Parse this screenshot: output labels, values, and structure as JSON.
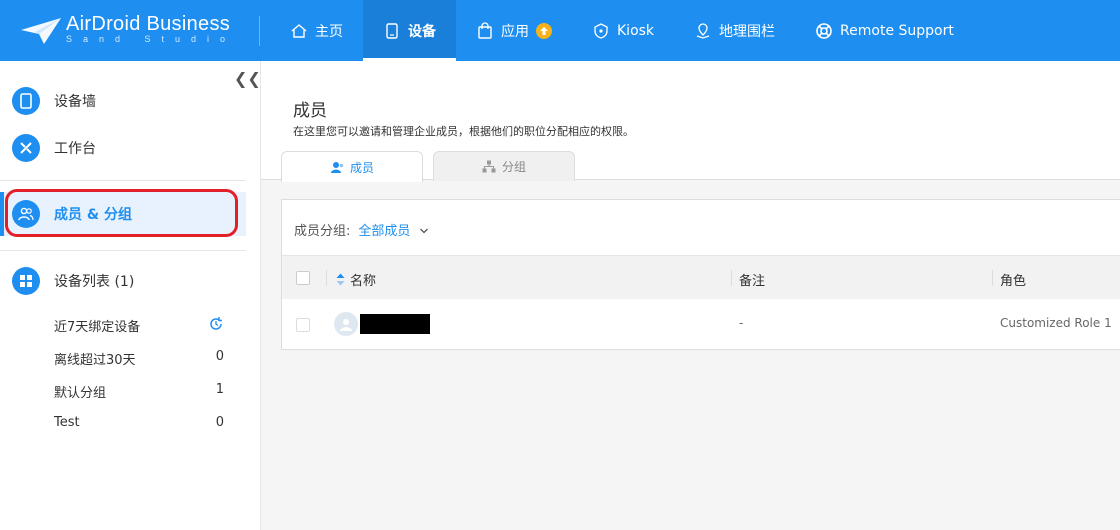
{
  "app": {
    "logo_title": "AirDroid Business",
    "logo_sub": "Sand Studio"
  },
  "nav": {
    "items": [
      {
        "label": "主页",
        "icon": "home-icon"
      },
      {
        "label": "设备",
        "icon": "tablet-icon",
        "active": true
      },
      {
        "label": "应用",
        "icon": "bag-icon",
        "badge": "upgrade-badge-icon"
      },
      {
        "label": "Kiosk",
        "icon": "lock-icon"
      },
      {
        "label": "地理围栏",
        "icon": "map-pin-icon"
      },
      {
        "label": "Remote Support",
        "icon": "lifebuoy-icon"
      }
    ]
  },
  "sidebar": {
    "items": [
      {
        "label": "设备墙",
        "icon": "tablet-icon"
      },
      {
        "label": "工作台",
        "icon": "tools-icon"
      },
      {
        "label": "成员 & 分组",
        "icon": "users-icon",
        "active": true
      },
      {
        "label": "设备列表 (1)",
        "icon": "grid-icon"
      }
    ],
    "sub_items": [
      {
        "label": "近7天绑定设备",
        "count": ""
      },
      {
        "label": "离线超过30天",
        "count": "0"
      },
      {
        "label": "默认分组",
        "count": "1"
      },
      {
        "label": "Test",
        "count": "0"
      }
    ]
  },
  "main": {
    "title": "成员",
    "description": "在这里您可以邀请和管理企业成员，根据他们的职位分配相应的权限。",
    "tabs": [
      {
        "label": "成员",
        "active": true
      },
      {
        "label": "分组"
      }
    ],
    "filter": {
      "label": "成员分组:",
      "value": "全部成员"
    },
    "table": {
      "columns": [
        "名称",
        "备注",
        "角色"
      ],
      "rows": [
        {
          "name": "",
          "note": "-",
          "role": "Customized Role 1"
        }
      ]
    }
  },
  "colors": {
    "brand": "#1e8ff0",
    "highlight": "#e1202a",
    "badge": "#f7b21b"
  }
}
